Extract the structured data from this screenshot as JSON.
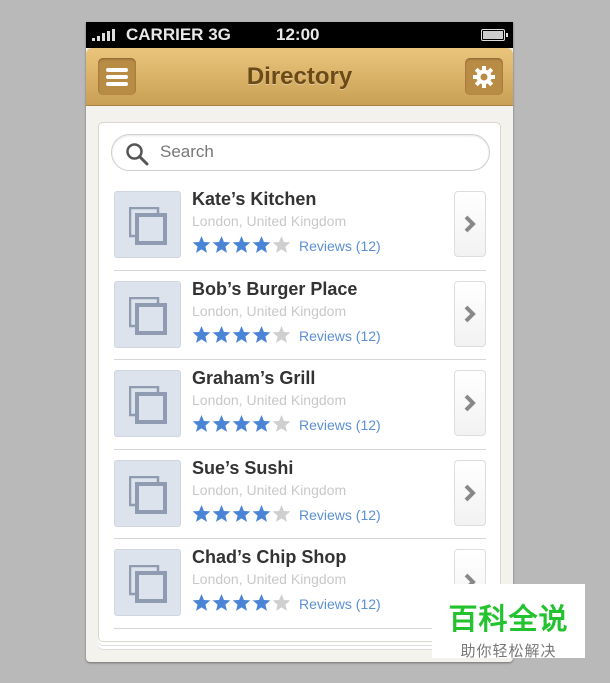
{
  "status_bar": {
    "carrier": "CARRIER",
    "network": "3G",
    "time": "12:00"
  },
  "header": {
    "title": "Directory",
    "menu_icon": "hamburger-icon",
    "settings_icon": "gear-icon"
  },
  "search": {
    "placeholder": "Search",
    "value": ""
  },
  "colors": {
    "header": "#d9b068",
    "star_on": "#4a84d6",
    "star_off": "#cfcfcf",
    "link": "#5b8fd6"
  },
  "items": [
    {
      "name": "Kate’s Kitchen",
      "location": "London, United Kingdom",
      "rating": 4,
      "max_rating": 5,
      "reviews": "Reviews (12)"
    },
    {
      "name": "Bob’s Burger Place",
      "location": "London, United Kingdom",
      "rating": 4,
      "max_rating": 5,
      "reviews": "Reviews (12)"
    },
    {
      "name": "Graham’s Grill",
      "location": "London, United Kingdom",
      "rating": 4,
      "max_rating": 5,
      "reviews": "Reviews (12)"
    },
    {
      "name": "Sue’s Sushi",
      "location": "London, United Kingdom",
      "rating": 4,
      "max_rating": 5,
      "reviews": "Reviews (12)"
    },
    {
      "name": "Chad’s Chip Shop",
      "location": "London, United Kingdom",
      "rating": 4,
      "max_rating": 5,
      "reviews": "Reviews (12)"
    }
  ],
  "watermark": {
    "title": "百科全说",
    "subtitle": "助你轻松解决"
  }
}
